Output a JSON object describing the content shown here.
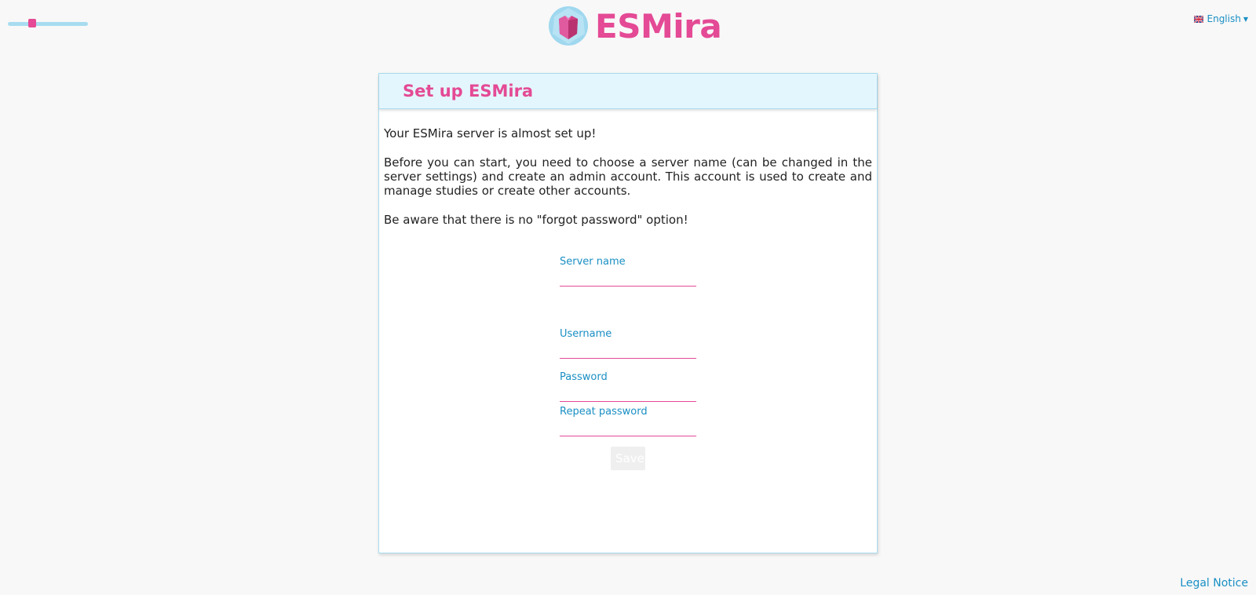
{
  "header": {
    "brand": "ESMira",
    "language": "English",
    "icons": {
      "logo": "esmira-logo-icon",
      "flag": "uk-flag-icon",
      "caret": "caret-down-icon"
    },
    "zoom_level": 0.28
  },
  "setup": {
    "title": "Set up ESMira",
    "intro": "Your ESMira server is almost set up!",
    "description": "Before you can start, you need to choose a server name (can be changed in the server settings) and create an admin account. This account is used to create and manage studies or create other accounts.",
    "warning": "Be aware that there is no \"forgot password\" option!",
    "fields": {
      "server_name": {
        "label": "Server name",
        "value": ""
      },
      "username": {
        "label": "Username",
        "value": ""
      },
      "password": {
        "label": "Password",
        "value": ""
      },
      "repeat_password": {
        "label": "Repeat password",
        "value": ""
      }
    },
    "save_label": "Save",
    "save_enabled": false
  },
  "footer": {
    "legal_notice": "Legal Notice"
  },
  "colors": {
    "accent_pink": "#e44a95",
    "link_blue": "#1a8fc4",
    "header_bg": "#e4f6fd",
    "border_blue": "#a9dcee"
  }
}
